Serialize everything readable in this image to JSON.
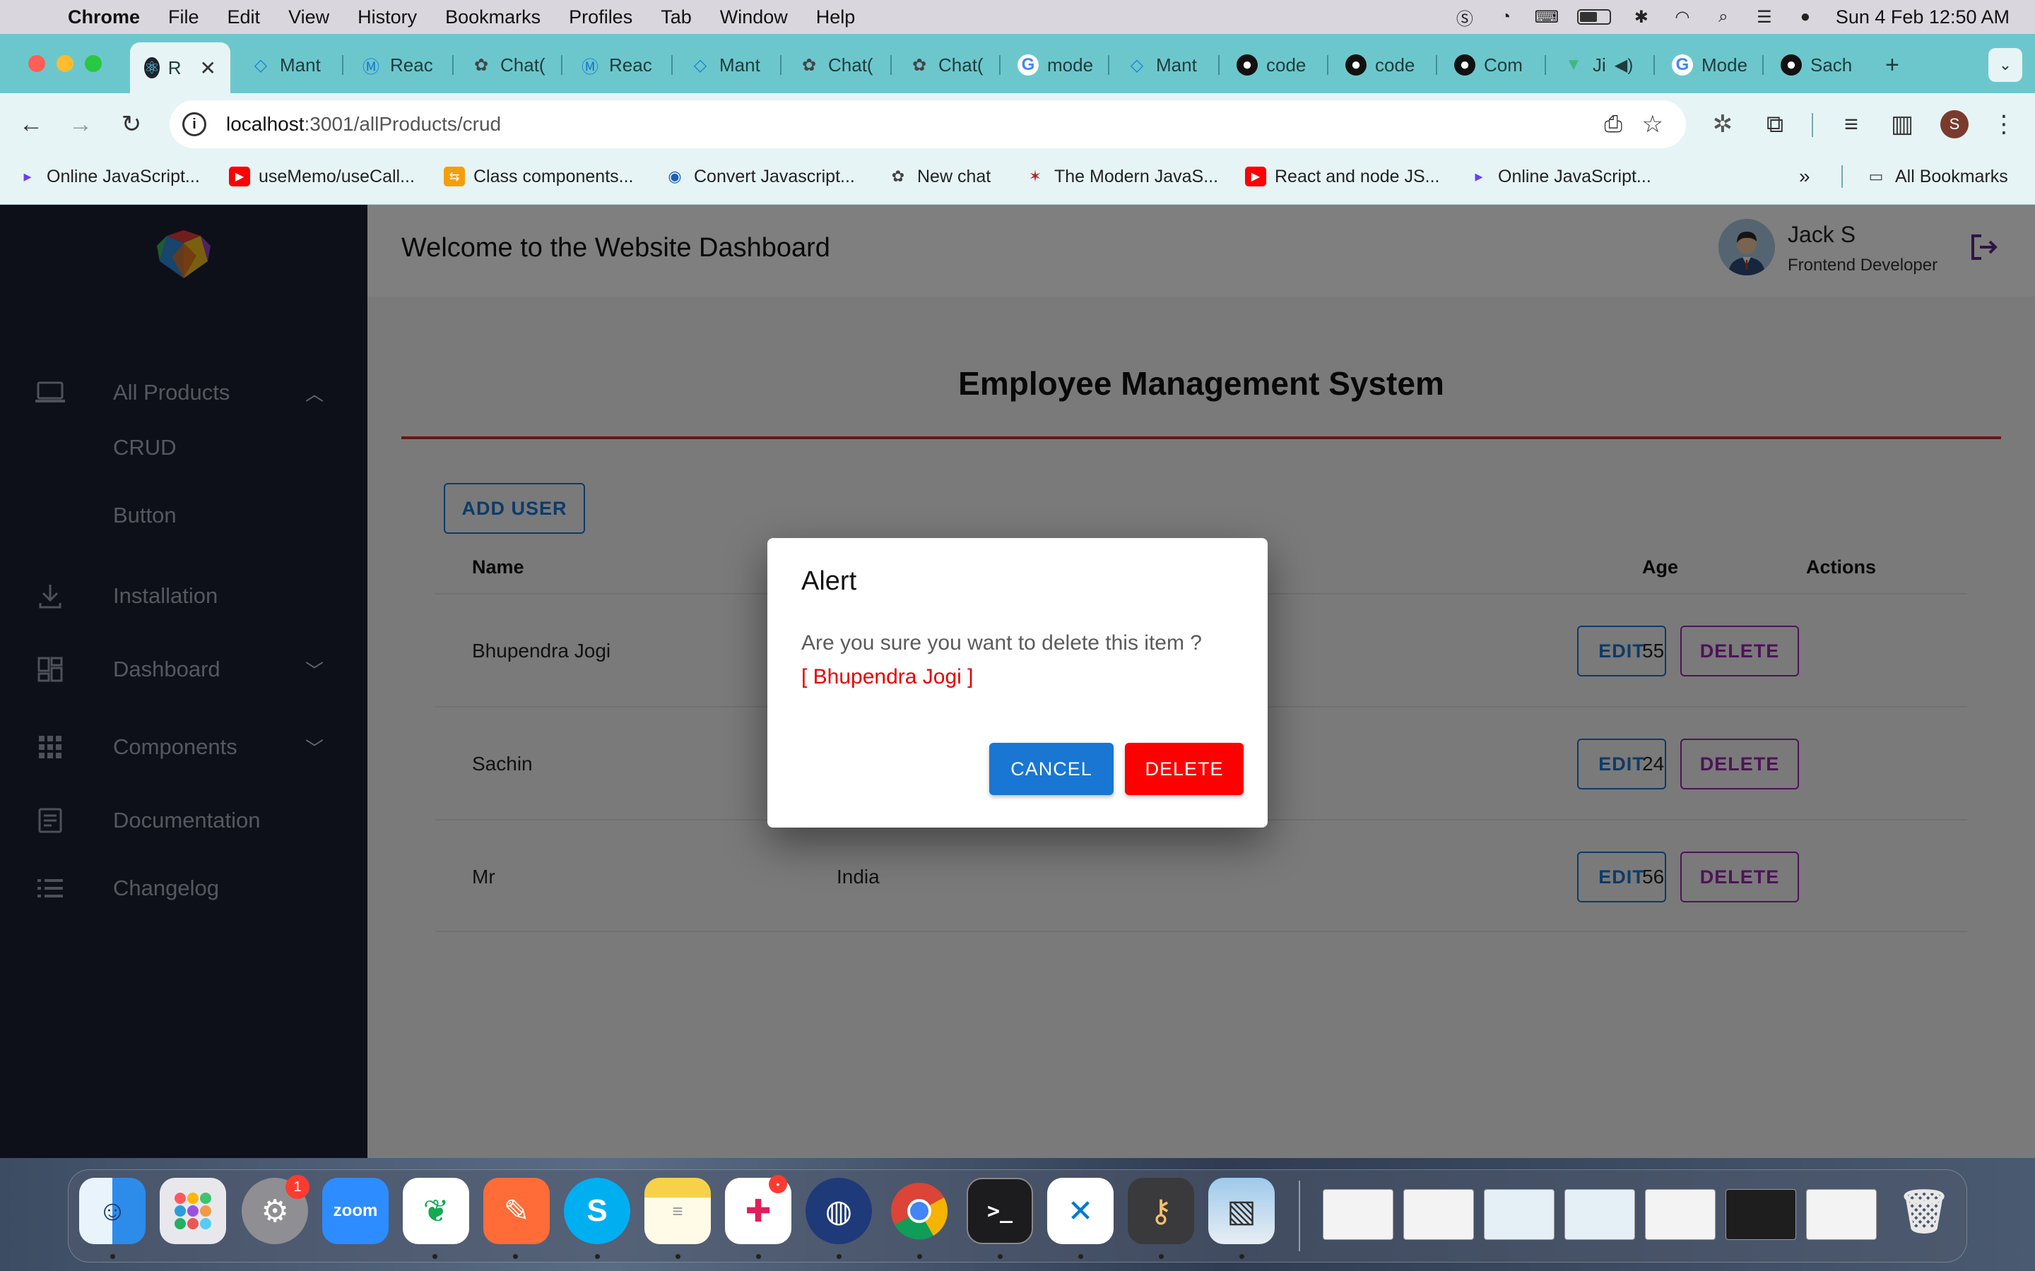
{
  "menubar": {
    "app": "Chrome",
    "menus": [
      "File",
      "Edit",
      "View",
      "History",
      "Bookmarks",
      "Profiles",
      "Tab",
      "Window",
      "Help"
    ],
    "datetime": "Sun 4 Feb  12:50 AM"
  },
  "browser": {
    "tabs": [
      {
        "label": "R",
        "icon": "react-icon",
        "active": true
      },
      {
        "label": "Mant",
        "icon": "mantine-icon"
      },
      {
        "label": "Reac",
        "icon": "mui-icon"
      },
      {
        "label": "Chat(",
        "icon": "chatgpt-icon"
      },
      {
        "label": "Reac",
        "icon": "mui-icon"
      },
      {
        "label": "Mant",
        "icon": "mantine-icon"
      },
      {
        "label": "Chat(",
        "icon": "chatgpt-icon"
      },
      {
        "label": "Chat(",
        "icon": "chatgpt-icon"
      },
      {
        "label": "mode",
        "icon": "google-icon"
      },
      {
        "label": "Mant",
        "icon": "mantine-icon"
      },
      {
        "label": "code",
        "icon": "github-icon"
      },
      {
        "label": "code",
        "icon": "github-icon"
      },
      {
        "label": "Com",
        "icon": "github-icon"
      },
      {
        "label": "Ji",
        "icon": "vue-icon"
      },
      {
        "label": "Mode",
        "icon": "google-icon"
      },
      {
        "label": "Sach",
        "icon": "github-icon"
      }
    ],
    "url_host": "localhost",
    "url_path": ":3001/allProducts/crud",
    "bookmarks": [
      "Online JavaScript...",
      "useMemo/useCall...",
      "Class components...",
      "Convert Javascript...",
      "New chat",
      "The Modern JavaS...",
      "React and node JS...",
      "Online JavaScript..."
    ],
    "all_bookmarks": "All Bookmarks",
    "profile_initial": "S"
  },
  "sidebar": {
    "items": [
      {
        "label": "All Products",
        "icon": "laptop-icon"
      },
      {
        "label": "Installation",
        "icon": "download-icon"
      },
      {
        "label": "Dashboard",
        "icon": "dashboard-icon"
      },
      {
        "label": "Components",
        "icon": "grid-icon"
      },
      {
        "label": "Documentation",
        "icon": "document-icon"
      },
      {
        "label": "Changelog",
        "icon": "list-icon"
      }
    ],
    "sub_items": [
      "CRUD",
      "Button"
    ]
  },
  "header": {
    "title": "Welcome to the Website Dashboard",
    "user_name": "Jack S",
    "user_role": "Frontend Developer"
  },
  "main": {
    "title": "Employee Management System",
    "add_user": "ADD USER",
    "columns": [
      "Name",
      "Age",
      "Actions"
    ],
    "rows": [
      {
        "name": "Bhupendra Jogi",
        "country": "",
        "age": "55"
      },
      {
        "name": "Sachin",
        "country": "",
        "age": "24"
      },
      {
        "name": "Mr",
        "country": "India",
        "age": "56"
      }
    ],
    "edit_label": "EDIT",
    "delete_label": "DELETE"
  },
  "dialog": {
    "title": "Alert",
    "message": "Are you sure you want to delete this item ?",
    "item": "[ Bhupendra Jogi ]",
    "cancel": "CANCEL",
    "delete": "DELETE"
  },
  "dock": {
    "apps": [
      "finder",
      "launchpad",
      "system-settings",
      "zoom",
      "mongodb-compass",
      "postman",
      "skype",
      "notes",
      "slack",
      "loop",
      "chrome",
      "terminal",
      "vscode",
      "keychain",
      "preview"
    ],
    "zoom_label": "zoom",
    "settings_badge": "1"
  },
  "colors": {
    "accent": "#1976d2",
    "delete_red": "#ff0000",
    "delete_outline": "#9c27b0",
    "sidebar": "#1b2130",
    "rule": "#d32f2f"
  }
}
